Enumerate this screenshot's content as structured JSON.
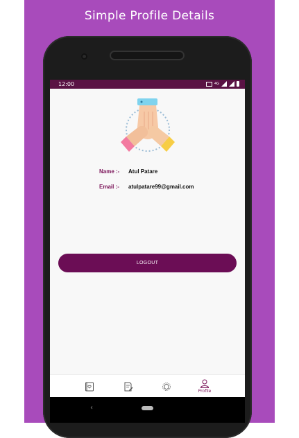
{
  "banner": {
    "title": "Simple Profile Details"
  },
  "statusbar": {
    "time": "12:00",
    "network": "4G"
  },
  "profile": {
    "name_label": "Name :-",
    "name_value": "Atul Patare",
    "email_label": "Email :-",
    "email_value": "atulpatare99@gmail.com"
  },
  "actions": {
    "logout_label": "LOGOUT"
  },
  "bottom_nav": {
    "items": [
      {
        "icon": "diary-icon",
        "label": ""
      },
      {
        "icon": "edit-note-icon",
        "label": ""
      },
      {
        "icon": "puzzle-icon",
        "label": ""
      },
      {
        "icon": "profile-icon",
        "label": "Profile",
        "active": true
      }
    ]
  },
  "colors": {
    "background": "#a84bbb",
    "accent": "#6b0d55",
    "status_bar": "#5a1244"
  }
}
